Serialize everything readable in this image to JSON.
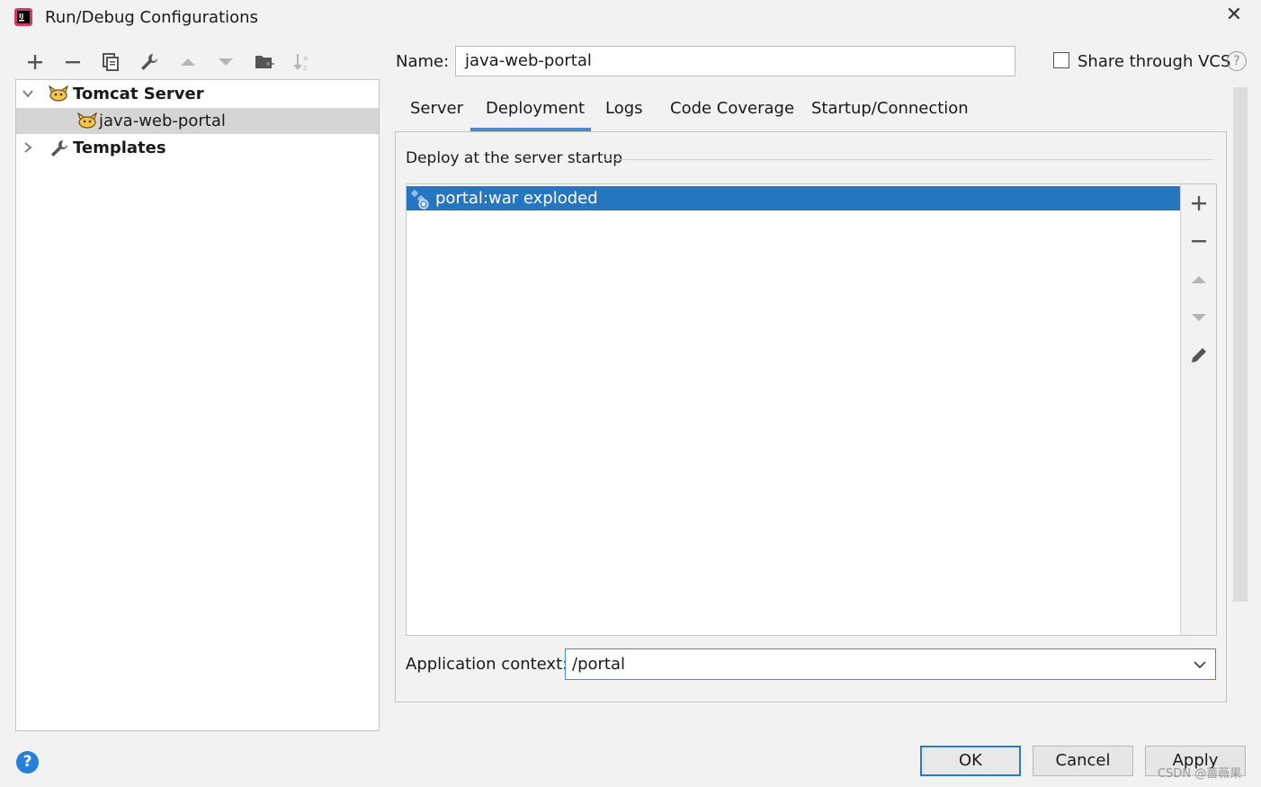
{
  "window": {
    "title": "Run/Debug Configurations",
    "close_glyph": "✕"
  },
  "toolbar": {
    "add_glyph": "+",
    "remove_glyph": "−"
  },
  "tree": {
    "items": [
      {
        "label": "Tomcat Server",
        "expanded": true,
        "icon": "tomcat-icon"
      },
      {
        "label": "java-web-portal",
        "selected": true,
        "icon": "tomcat-icon"
      },
      {
        "label": "Templates",
        "expanded": false,
        "icon": "wrench-icon"
      }
    ]
  },
  "name_field": {
    "label": "Name:",
    "value": "java-web-portal"
  },
  "share_vcs": {
    "label": "Share through VCS",
    "checked": false,
    "help_glyph": "?"
  },
  "tabs": [
    {
      "label": "Server"
    },
    {
      "label": "Deployment",
      "active": true
    },
    {
      "label": "Logs"
    },
    {
      "label": "Code Coverage"
    },
    {
      "label": "Startup/Connection"
    }
  ],
  "deployment": {
    "section_title": "Deploy at the server startup",
    "items": [
      {
        "label": "portal:war exploded",
        "selected": true
      }
    ],
    "side_add_glyph": "+",
    "side_remove_glyph": "−"
  },
  "app_context": {
    "label": "Application context:",
    "value": "/portal"
  },
  "footer": {
    "help_glyph": "?",
    "ok_label": "OK",
    "cancel_label": "Cancel",
    "apply_label": "Apply",
    "watermark": "CSDN @蔷薇果"
  },
  "colors": {
    "accent": "#2675bf",
    "selection_gray": "#d5d5d5",
    "background": "#f2f2f2"
  }
}
